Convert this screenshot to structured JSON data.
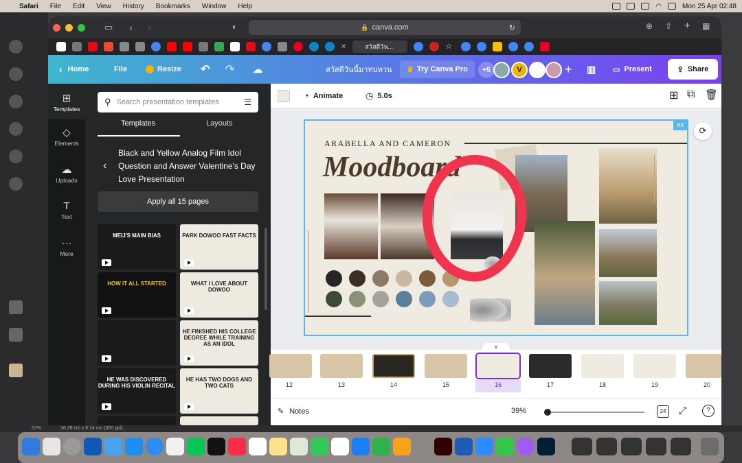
{
  "menubar": {
    "apple": "",
    "items": [
      "Safari",
      "File",
      "Edit",
      "View",
      "History",
      "Bookmarks",
      "Window",
      "Help"
    ],
    "datetime": "Mon 25 Apr  02:48"
  },
  "browser": {
    "url": "canva.com",
    "active_tab": "สวัสดีวัน..."
  },
  "canva_header": {
    "home": "Home",
    "file": "File",
    "resize": "Resize",
    "doc_title": "สวัสดีวันนี้มาทบทวน",
    "try_pro": "Try Canva Pro",
    "collab_count": "+5",
    "avatar_letter": "V",
    "present": "Present",
    "share": "Share"
  },
  "rail": [
    {
      "label": "Templates",
      "icon": "templates-icon"
    },
    {
      "label": "Elements",
      "icon": "elements-icon"
    },
    {
      "label": "Uploads",
      "icon": "uploads-icon"
    },
    {
      "label": "Text",
      "icon": "text-icon"
    },
    {
      "label": "More",
      "icon": "more-icon"
    }
  ],
  "panel": {
    "search_placeholder": "Search presentation templates",
    "tab_templates": "Templates",
    "tab_layouts": "Layouts",
    "template_title": "Black and Yellow Analog Film Idol Question and Answer Valentine's Day Love Presentation",
    "apply_button": "Apply all 15 pages",
    "thumbs": [
      {
        "text": "MEIJ'S MAIN BIAS",
        "theme": "dark"
      },
      {
        "text": "PARK DOWOO FAST FACTS",
        "theme": "light"
      },
      {
        "text": "HOW IT ALL STARTED",
        "theme": "dark"
      },
      {
        "text": "WHAT I LOVE ABOUT DOWOO",
        "theme": "light"
      },
      {
        "text": "",
        "theme": "dark"
      },
      {
        "text": "HE FINISHED HIS COLLEGE DEGREE WHILE TRAINING AS AN IDOL",
        "theme": "light"
      },
      {
        "text": "HE WAS DISCOVERED DURING HIS VIOLIN RECITAL",
        "theme": "dark"
      },
      {
        "text": "HE HAS TWO DOGS AND TWO CATS",
        "theme": "light"
      }
    ]
  },
  "toolbar": {
    "animate": "Animate",
    "duration": "5.0s"
  },
  "slide": {
    "names": "ARABELLA AND CAMERON",
    "title": "Moodboard",
    "badge": "KK",
    "swatches": [
      "#262626",
      "#3b2e26",
      "#8b7a66",
      "#c9b79e",
      "#7c5a3a",
      "#b89473",
      "#3d4a35",
      "#8a917a",
      "#a3a39b",
      "#5a7f99",
      "#7b9cb8",
      "#a9bccf"
    ],
    "accent_circle": "#f0344e"
  },
  "filmstrip": {
    "pages": [
      "12",
      "13",
      "14",
      "15",
      "16",
      "17",
      "18",
      "19",
      "20"
    ],
    "selected": "16"
  },
  "bottombar": {
    "notes": "Notes",
    "zoom": "39%",
    "page_indicator": "24"
  },
  "statusstrip": {
    "zoom": "57%",
    "size": "16.26 cm x 9.14 cm (300 ppi)"
  }
}
